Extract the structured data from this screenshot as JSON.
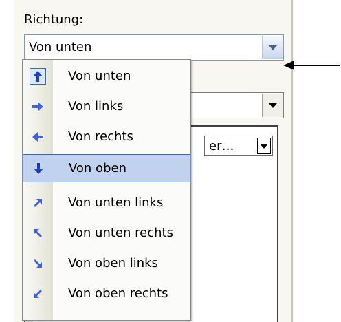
{
  "direction_label": "Richtung:",
  "direction_combo": {
    "value": "Von unten"
  },
  "background_combo_value": "er…",
  "dropdown": {
    "items": [
      {
        "label": "Von unten",
        "icon": "arrow-up-icon",
        "state": "checked"
      },
      {
        "label": "Von links",
        "icon": "arrow-right-icon",
        "state": "normal"
      },
      {
        "label": "Von rechts",
        "icon": "arrow-left-icon",
        "state": "normal"
      },
      {
        "label": "Von oben",
        "icon": "arrow-down-icon",
        "state": "highlighted"
      },
      {
        "label": "Von unten links",
        "icon": "arrow-up-right-icon",
        "state": "normal"
      },
      {
        "label": "Von unten rechts",
        "icon": "arrow-up-left-icon",
        "state": "normal"
      },
      {
        "label": "Von oben links",
        "icon": "arrow-down-right-icon",
        "state": "normal"
      },
      {
        "label": "Von oben rechts",
        "icon": "arrow-down-left-icon",
        "state": "normal"
      }
    ]
  },
  "colors": {
    "icon_blue": "#2f55d4",
    "highlight": "#c1d2ee",
    "highlight_border": "#316ac5"
  }
}
